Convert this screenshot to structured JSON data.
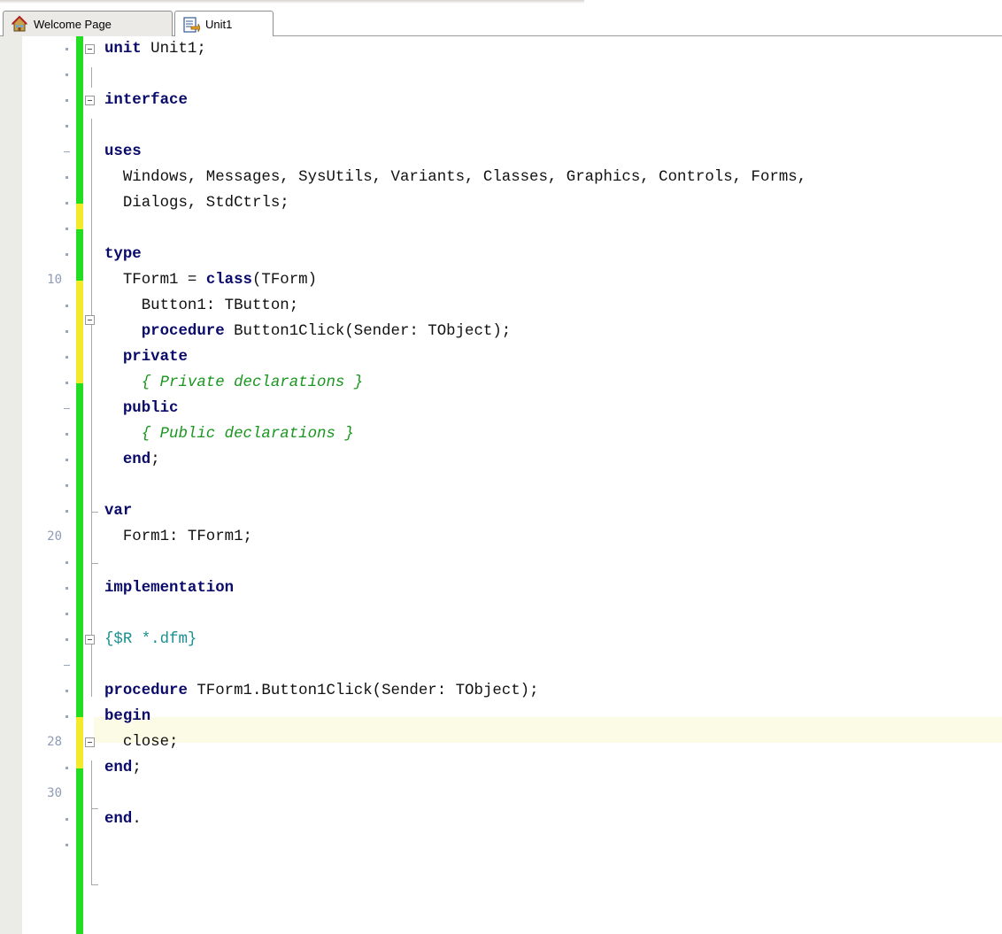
{
  "tabs": [
    {
      "label": "Welcome Page",
      "icon": "home-icon",
      "active": false
    },
    {
      "label": "Unit1",
      "icon": "unit-file-icon",
      "active": true
    }
  ],
  "editor": {
    "current_line": 28,
    "line_numbers_shown": [
      "10",
      "20",
      "28",
      "30"
    ],
    "lines": [
      [
        {
          "t": "unit",
          "k": "kw"
        },
        {
          "t": " Unit1;"
        }
      ],
      [],
      [
        {
          "t": "interface",
          "k": "kw"
        }
      ],
      [],
      [
        {
          "t": "uses",
          "k": "kw"
        }
      ],
      [
        {
          "t": "  Windows, Messages, SysUtils, Variants, Classes, Graphics, Controls, Forms,"
        }
      ],
      [
        {
          "t": "  Dialogs, StdCtrls;"
        }
      ],
      [],
      [
        {
          "t": "type",
          "k": "kw"
        }
      ],
      [
        {
          "t": "  TForm1 = "
        },
        {
          "t": "class",
          "k": "kw"
        },
        {
          "t": "(TForm)"
        }
      ],
      [
        {
          "t": "    Button1: TButton;"
        }
      ],
      [
        {
          "t": "    "
        },
        {
          "t": "procedure",
          "k": "kw"
        },
        {
          "t": " Button1Click(Sender: TObject);"
        }
      ],
      [
        {
          "t": "  "
        },
        {
          "t": "private",
          "k": "kw"
        }
      ],
      [
        {
          "t": "    { Private declarations }",
          "k": "cm"
        }
      ],
      [
        {
          "t": "  "
        },
        {
          "t": "public",
          "k": "kw"
        }
      ],
      [
        {
          "t": "    { Public declarations }",
          "k": "cm"
        }
      ],
      [
        {
          "t": "  "
        },
        {
          "t": "end",
          "k": "kw"
        },
        {
          "t": ";"
        }
      ],
      [],
      [
        {
          "t": "var",
          "k": "kw"
        }
      ],
      [
        {
          "t": "  Form1: TForm1;"
        }
      ],
      [],
      [
        {
          "t": "implementation",
          "k": "kw"
        }
      ],
      [],
      [
        {
          "t": "{$R *.dfm}",
          "k": "dr"
        }
      ],
      [],
      [
        {
          "t": "procedure",
          "k": "kw"
        },
        {
          "t": " TForm1.Button1Click(Sender: TObject);"
        }
      ],
      [
        {
          "t": "begin",
          "k": "kw"
        }
      ],
      [
        {
          "t": "  close;"
        }
      ],
      [
        {
          "t": "end",
          "k": "kw"
        },
        {
          "t": ";"
        }
      ],
      [],
      [
        {
          "t": "end",
          "k": "kw"
        },
        {
          "t": "."
        }
      ],
      []
    ]
  },
  "colors": {
    "keyword": "#0a0a6a",
    "comment": "#18961e",
    "directive": "#1a8f8f",
    "change_saved": "#22dd22",
    "change_unsaved": "#f2ea2a",
    "current_line_bg": "#fbfbe6"
  }
}
